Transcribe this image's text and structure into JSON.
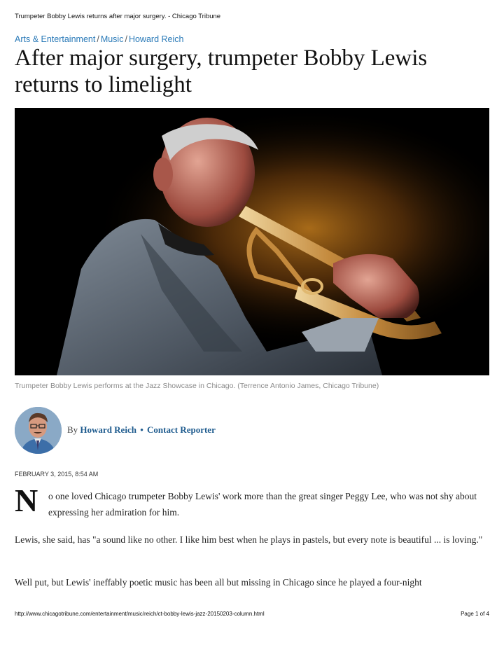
{
  "print_header": {
    "title": "Trumpeter Bobby Lewis returns after major surgery. - Chicago Tribune"
  },
  "breadcrumb": {
    "section": "Arts & Entertainment",
    "subsection": "Music",
    "author": "Howard Reich",
    "separator": "/"
  },
  "article": {
    "headline": "After major surgery, trumpeter Bobby Lewis returns to limelight",
    "photo_caption": "Trumpeter Bobby Lewis performs at the Jazz Showcase in Chicago. (Terrence Antonio James, Chicago Tribune)",
    "byline_prefix": "By",
    "author": "Howard Reich",
    "byline_separator": "•",
    "contact_label": "Contact Reporter",
    "date": "FEBRUARY 3, 2015, 8:54 AM",
    "dropcap": "N",
    "paragraphs": [
      "o one loved Chicago trumpeter Bobby Lewis' work more than the great singer Peggy Lee, who was not shy about expressing her admiration for him.",
      "Lewis, she said, has \"a sound like no other. I like him best when he plays in pastels, but every note is beautiful ... is loving.\"",
      "Well put, but Lewis' ineffably poetic music has been all but missing in Chicago since he played a four-night"
    ]
  },
  "print_footer": {
    "url": "http://www.chicagotribune.com/entertainment/music/reich/ct-bobby-lewis-jazz-20150203-column.html",
    "page_indicator": "Page 1 of 4"
  },
  "colors": {
    "link": "#2a7ab8",
    "byline_link": "#1e5b8e",
    "caption": "#8a8a8a"
  }
}
